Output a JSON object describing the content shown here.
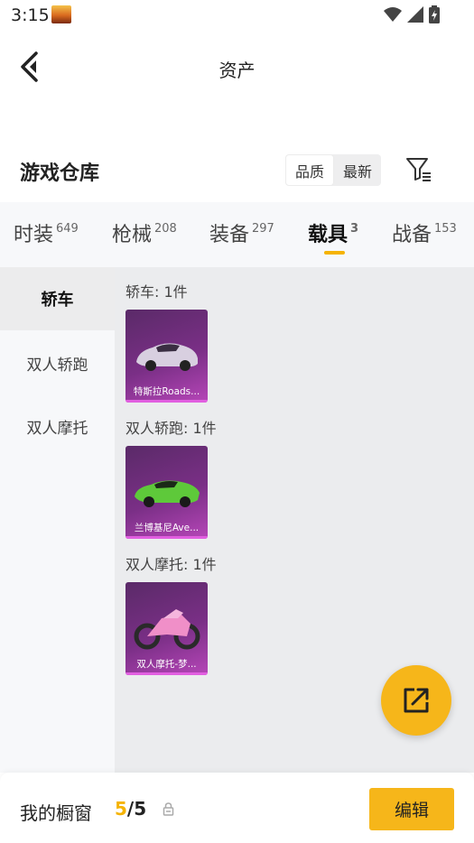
{
  "status_bar": {
    "time": "3:15"
  },
  "header": {
    "title": "资产"
  },
  "section": {
    "title": "游戏仓库",
    "sort_options": [
      "品质",
      "最新"
    ],
    "active_sort": 0
  },
  "tabs": [
    {
      "label": "时装",
      "count": "649"
    },
    {
      "label": "枪械",
      "count": "208"
    },
    {
      "label": "装备",
      "count": "297"
    },
    {
      "label": "载具",
      "count": "3",
      "active": true
    },
    {
      "label": "战备",
      "count": "153"
    }
  ],
  "sidebar": {
    "items": [
      {
        "label": "轿车",
        "active": true
      },
      {
        "label": "双人轿跑"
      },
      {
        "label": "双人摩托"
      }
    ]
  },
  "groups": [
    {
      "label": "轿车: 1件",
      "items": [
        {
          "name": "特斯拉Roads..."
        }
      ]
    },
    {
      "label": "双人轿跑: 1件",
      "items": [
        {
          "name": "兰博基尼Ave..."
        }
      ]
    },
    {
      "label": "双人摩托: 1件",
      "items": [
        {
          "name": "双人摩托-梦..."
        }
      ]
    }
  ],
  "bottom_bar": {
    "showcase_label": "我的橱窗",
    "showcase_current": "5",
    "showcase_sep": "/",
    "showcase_max": "5",
    "edit_label": "编辑"
  },
  "colors": {
    "accent": "#f5b301",
    "card_gradient_start": "#5a2a68",
    "card_gradient_end": "#b646b8"
  },
  "icons": [
    "back-arrow-icon",
    "filter-icon",
    "share-external-icon",
    "lock-icon",
    "wifi-icon",
    "signal-icon",
    "battery-icon"
  ]
}
